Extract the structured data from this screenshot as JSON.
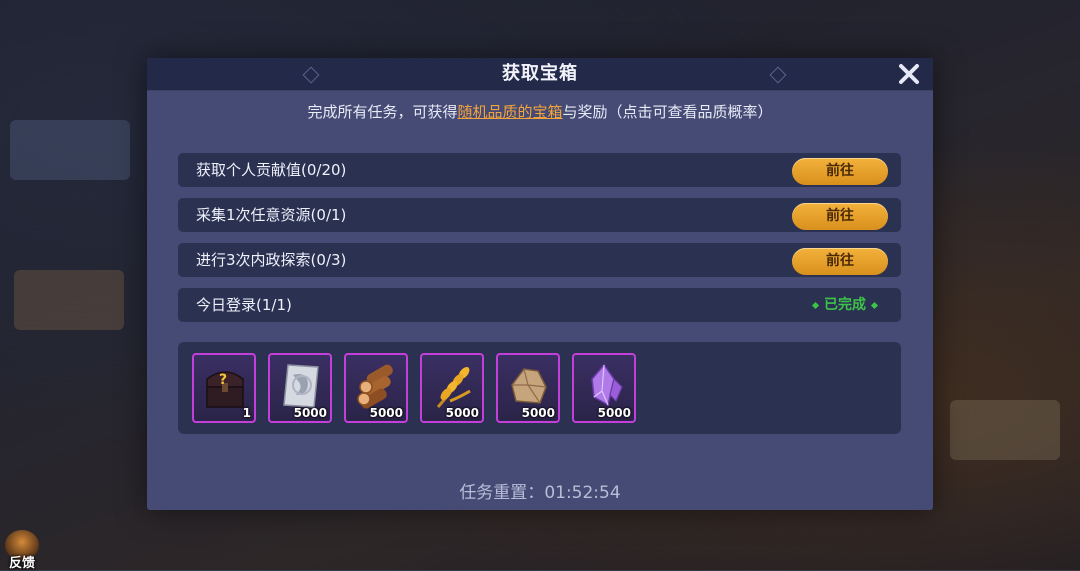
{
  "dialog": {
    "title": "获取宝箱",
    "subtitle_prefix": "完成所有任务，可获得",
    "subtitle_link": "随机品质的宝箱",
    "subtitle_suffix": "与奖励（点击可查看品质概率）",
    "close_icon": "close-icon"
  },
  "tasks": [
    {
      "label": "获取个人贡献值(0/20)",
      "action": "前往",
      "status": "pending"
    },
    {
      "label": "采集1次任意资源(0/1)",
      "action": "前往",
      "status": "pending"
    },
    {
      "label": "进行3次内政探索(0/3)",
      "action": "前往",
      "status": "pending"
    },
    {
      "label": "今日登录(1/1)",
      "action": "已完成",
      "status": "done"
    }
  ],
  "rewards": [
    {
      "icon": "mystery-chest-icon",
      "qty": "1"
    },
    {
      "icon": "silver-coin-icon",
      "qty": "5000"
    },
    {
      "icon": "wood-logs-icon",
      "qty": "5000"
    },
    {
      "icon": "wheat-icon",
      "qty": "5000"
    },
    {
      "icon": "stone-icon",
      "qty": "5000"
    },
    {
      "icon": "crystal-icon",
      "qty": "5000"
    }
  ],
  "reset": {
    "label": "任务重置：",
    "time": "01:52:54"
  },
  "feedback": {
    "label": "反馈"
  },
  "colors": {
    "accent": "#f3a33c",
    "button": "#e0a02a",
    "done": "#3ec34a",
    "item_border": "#c43fd9",
    "panel": "#454b74",
    "row": "#2a3151"
  }
}
